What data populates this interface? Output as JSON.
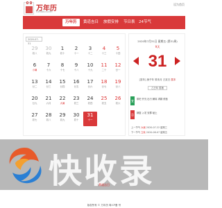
{
  "header": {
    "logo_title": "万年历",
    "logo_sub": "fuhaoo.com",
    "top_link": "设为首页"
  },
  "nav": {
    "items": [
      {
        "label": "万年历",
        "active": true
      },
      {
        "label": "黄道吉日",
        "active": false
      },
      {
        "label": "放假安排",
        "active": false
      },
      {
        "label": "节日表",
        "active": false
      },
      {
        "label": "24节气",
        "active": false
      }
    ]
  },
  "calendar": {
    "date_select": "2020-07-31",
    "weeks": [
      [
        {
          "d": "29",
          "s": "初八",
          "t": "prev"
        },
        {
          "d": "30",
          "s": "初九",
          "t": "prev"
        },
        {
          "d": "1",
          "s": "初十",
          "t": ""
        },
        {
          "d": "2",
          "s": "十一",
          "t": ""
        },
        {
          "d": "3",
          "s": "十二",
          "t": ""
        },
        {
          "d": "4",
          "s": "十三",
          "t": "weekend"
        },
        {
          "d": "5",
          "s": "十四",
          "t": "weekend"
        }
      ],
      [
        {
          "d": "6",
          "s": "小暑",
          "t": "",
          "sred": true
        },
        {
          "d": "7",
          "s": "十六",
          "t": ""
        },
        {
          "d": "8",
          "s": "十七",
          "t": ""
        },
        {
          "d": "9",
          "s": "十八",
          "t": ""
        },
        {
          "d": "10",
          "s": "十九",
          "t": ""
        },
        {
          "d": "11",
          "s": "二十",
          "t": "weekend"
        },
        {
          "d": "12",
          "s": "廿一",
          "t": "weekend"
        }
      ],
      [
        {
          "d": "13",
          "s": "廿二",
          "t": ""
        },
        {
          "d": "14",
          "s": "廿三",
          "t": ""
        },
        {
          "d": "15",
          "s": "廿四",
          "t": ""
        },
        {
          "d": "16",
          "s": "廿五",
          "t": ""
        },
        {
          "d": "17",
          "s": "廿六",
          "t": ""
        },
        {
          "d": "18",
          "s": "廿七",
          "t": "weekend"
        },
        {
          "d": "19",
          "s": "廿八",
          "t": "weekend"
        }
      ],
      [
        {
          "d": "20",
          "s": "廿九",
          "t": ""
        },
        {
          "d": "21",
          "s": "六月",
          "t": ""
        },
        {
          "d": "22",
          "s": "大暑",
          "t": "",
          "sred": true
        },
        {
          "d": "23",
          "s": "初三",
          "t": ""
        },
        {
          "d": "24",
          "s": "初四",
          "t": ""
        },
        {
          "d": "25",
          "s": "初五",
          "t": "weekend"
        },
        {
          "d": "26",
          "s": "初六",
          "t": "weekend"
        }
      ],
      [
        {
          "d": "27",
          "s": "初七",
          "t": ""
        },
        {
          "d": "28",
          "s": "初八",
          "t": ""
        },
        {
          "d": "29",
          "s": "初九",
          "t": ""
        },
        {
          "d": "30",
          "s": "初十",
          "t": ""
        },
        {
          "d": "31",
          "s": "十一",
          "t": "selected"
        },
        {
          "d": "",
          "s": "",
          "t": ""
        },
        {
          "d": "",
          "s": "",
          "t": ""
        }
      ]
    ]
  },
  "detail": {
    "date_line": "2020年7月31日 星期五 (第31周)",
    "month_label": "9天",
    "big_day": "31",
    "ganzhi": "[鼠年] 庚子年 癸未月 己亥日",
    "ganzhi_link": "属本",
    "tag": "乙巳年 属猪",
    "yi_label": "宜",
    "yi_text": "祭祀 开光 出行 解除 求嗣 修造",
    "ji_label": "忌",
    "ji_text": "嫁娶 入宅 安葬 破土",
    "jieqi": [
      {
        "k": "上一节气",
        "v": "大暑",
        "date": "2020-07-22 星期三"
      },
      {
        "k": "下一节气",
        "v": "立秋",
        "date": "2020-08-07 星期五"
      }
    ]
  },
  "watermark": {
    "text": "快收录"
  },
  "footer": {
    "link": "黄道吉日",
    "copyright": "版权所有 © 万年历  粤ICP备 号"
  },
  "colors": {
    "accent": "#d9393a",
    "yi": "#2aa05a"
  }
}
